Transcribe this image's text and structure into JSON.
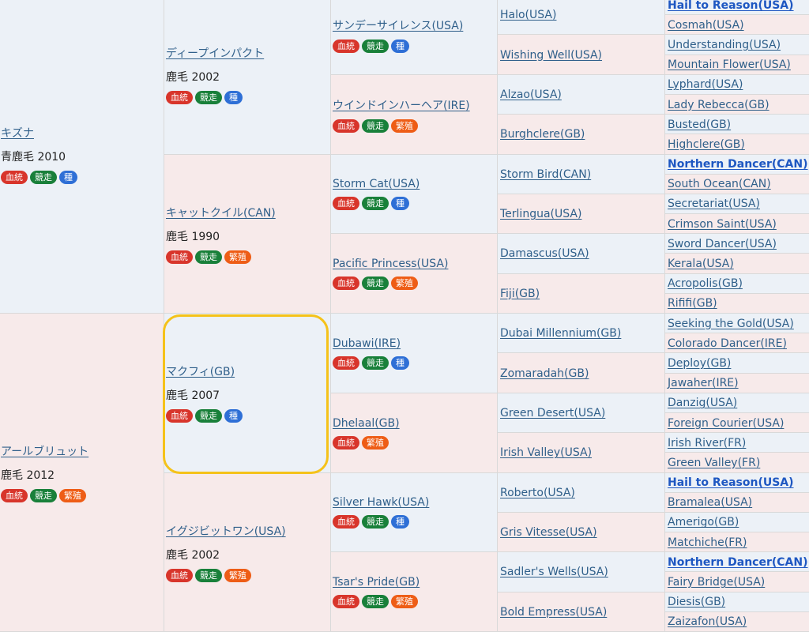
{
  "badge_colors": {
    "blood": "#d8352b",
    "race": "#19803a",
    "sire": "#2e6fd6",
    "breed": "#ee5d16"
  },
  "highlight_color": "#f5c21a",
  "col1": [
    {
      "name": "キズナ",
      "detail": "青鹿毛 2010",
      "badges": [
        {
          "t": "血統",
          "c": "blood"
        },
        {
          "t": "競走",
          "c": "race"
        },
        {
          "t": "種",
          "c": "sire"
        }
      ]
    },
    {
      "name": "アールブリュット",
      "detail": "鹿毛 2012",
      "badges": [
        {
          "t": "血統",
          "c": "blood"
        },
        {
          "t": "競走",
          "c": "race"
        },
        {
          "t": "繁殖",
          "c": "breed"
        }
      ]
    }
  ],
  "col2": [
    {
      "name": "ディープインパクト",
      "detail": "鹿毛 2002",
      "badges": [
        {
          "t": "血統",
          "c": "blood"
        },
        {
          "t": "競走",
          "c": "race"
        },
        {
          "t": "種",
          "c": "sire"
        }
      ]
    },
    {
      "name": "キャットクイル(CAN)",
      "detail": "鹿毛 1990",
      "badges": [
        {
          "t": "血統",
          "c": "blood"
        },
        {
          "t": "競走",
          "c": "race"
        },
        {
          "t": "繁殖",
          "c": "breed"
        }
      ]
    },
    {
      "name": "マクフィ(GB)",
      "detail": "鹿毛 2007",
      "badges": [
        {
          "t": "血統",
          "c": "blood"
        },
        {
          "t": "競走",
          "c": "race"
        },
        {
          "t": "種",
          "c": "sire"
        }
      ]
    },
    {
      "name": "イグジビットワン(USA)",
      "detail": "鹿毛 2002",
      "badges": [
        {
          "t": "血統",
          "c": "blood"
        },
        {
          "t": "競走",
          "c": "race"
        },
        {
          "t": "繁殖",
          "c": "breed"
        }
      ]
    }
  ],
  "col3": [
    {
      "name": "サンデーサイレンス(USA)",
      "badges": [
        {
          "t": "血統",
          "c": "blood"
        },
        {
          "t": "競走",
          "c": "race"
        },
        {
          "t": "種",
          "c": "sire"
        }
      ]
    },
    {
      "name": "ウインドインハーヘア(IRE)",
      "badges": [
        {
          "t": "血統",
          "c": "blood"
        },
        {
          "t": "競走",
          "c": "race"
        },
        {
          "t": "繁殖",
          "c": "breed"
        }
      ]
    },
    {
      "name": "Storm Cat(USA)",
      "badges": [
        {
          "t": "血統",
          "c": "blood"
        },
        {
          "t": "競走",
          "c": "race"
        },
        {
          "t": "種",
          "c": "sire"
        }
      ]
    },
    {
      "name": "Pacific Princess(USA)",
      "badges": [
        {
          "t": "血統",
          "c": "blood"
        },
        {
          "t": "競走",
          "c": "race"
        },
        {
          "t": "繁殖",
          "c": "breed"
        }
      ]
    },
    {
      "name": "Dubawi(IRE)",
      "badges": [
        {
          "t": "血統",
          "c": "blood"
        },
        {
          "t": "競走",
          "c": "race"
        },
        {
          "t": "種",
          "c": "sire"
        }
      ]
    },
    {
      "name": "Dhelaal(GB)",
      "badges": [
        {
          "t": "血統",
          "c": "blood"
        },
        {
          "t": "繁殖",
          "c": "breed"
        }
      ]
    },
    {
      "name": "Silver Hawk(USA)",
      "badges": [
        {
          "t": "血統",
          "c": "blood"
        },
        {
          "t": "競走",
          "c": "race"
        },
        {
          "t": "種",
          "c": "sire"
        }
      ]
    },
    {
      "name": "Tsar's Pride(GB)",
      "badges": [
        {
          "t": "血統",
          "c": "blood"
        },
        {
          "t": "競走",
          "c": "race"
        },
        {
          "t": "繁殖",
          "c": "breed"
        }
      ]
    }
  ],
  "col4": [
    {
      "name": "Halo(USA)"
    },
    {
      "name": "Wishing Well(USA)"
    },
    {
      "name": "Alzao(USA)"
    },
    {
      "name": "Burghclere(GB)"
    },
    {
      "name": "Storm Bird(CAN)"
    },
    {
      "name": "Terlingua(USA)"
    },
    {
      "name": "Damascus(USA)"
    },
    {
      "name": "Fiji(GB)"
    },
    {
      "name": "Dubai Millennium(GB)"
    },
    {
      "name": "Zomaradah(GB)"
    },
    {
      "name": "Green Desert(USA)"
    },
    {
      "name": "Irish Valley(USA)"
    },
    {
      "name": "Roberto(USA)"
    },
    {
      "name": "Gris Vitesse(USA)"
    },
    {
      "name": "Sadler's Wells(USA)"
    },
    {
      "name": "Bold Empress(USA)"
    }
  ],
  "col5": [
    {
      "name": "Hail to Reason(USA)",
      "bold": true
    },
    {
      "name": "Cosmah(USA)"
    },
    {
      "name": "Understanding(USA)"
    },
    {
      "name": "Mountain Flower(USA)"
    },
    {
      "name": "Lyphard(USA)"
    },
    {
      "name": "Lady Rebecca(GB)"
    },
    {
      "name": "Busted(GB)"
    },
    {
      "name": "Highclere(GB)"
    },
    {
      "name": "Northern Dancer(CAN)",
      "bold": true
    },
    {
      "name": "South Ocean(CAN)"
    },
    {
      "name": "Secretariat(USA)"
    },
    {
      "name": "Crimson Saint(USA)"
    },
    {
      "name": "Sword Dancer(USA)"
    },
    {
      "name": "Kerala(USA)"
    },
    {
      "name": "Acropolis(GB)"
    },
    {
      "name": "Rififi(GB)"
    },
    {
      "name": "Seeking the Gold(USA)"
    },
    {
      "name": "Colorado Dancer(IRE)"
    },
    {
      "name": "Deploy(GB)"
    },
    {
      "name": "Jawaher(IRE)"
    },
    {
      "name": "Danzig(USA)"
    },
    {
      "name": "Foreign Courier(USA)"
    },
    {
      "name": "Irish River(FR)"
    },
    {
      "name": "Green Valley(FR)"
    },
    {
      "name": "Hail to Reason(USA)",
      "bold": true
    },
    {
      "name": "Bramalea(USA)"
    },
    {
      "name": "Amerigo(GB)"
    },
    {
      "name": "Matchiche(FR)"
    },
    {
      "name": "Northern Dancer(CAN)",
      "bold": true
    },
    {
      "name": "Fairy Bridge(USA)"
    },
    {
      "name": "Diesis(GB)"
    },
    {
      "name": "Zaizafon(USA)"
    }
  ]
}
